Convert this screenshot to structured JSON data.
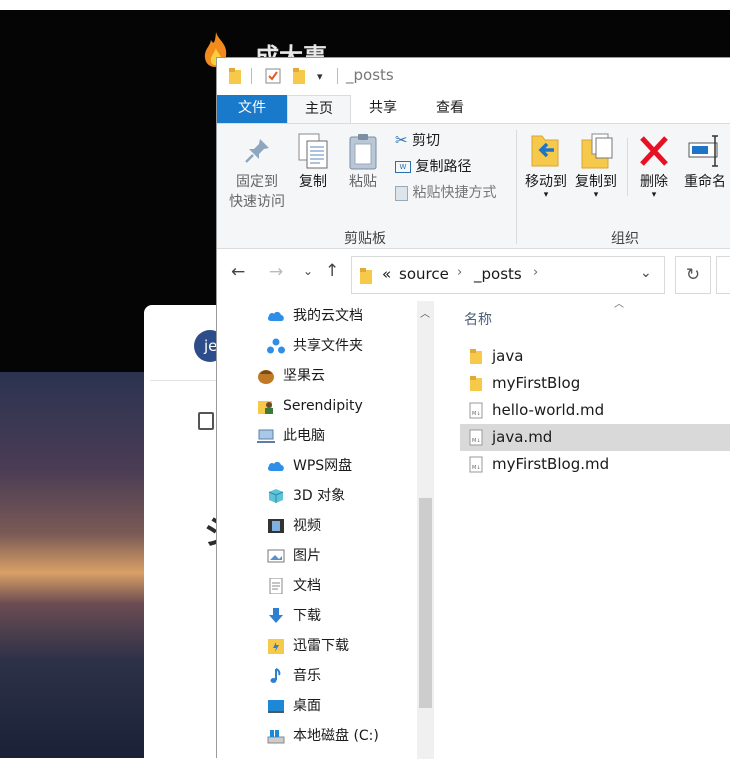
{
  "background": {
    "site_title": "成大事",
    "badge_text": "je",
    "heading_glyph": "ジ"
  },
  "explorer": {
    "title": "_posts",
    "tabs": [
      "文件",
      "主页",
      "共享",
      "查看"
    ],
    "ribbon": {
      "pin_line1": "固定到",
      "pin_line2": "快速访问",
      "copy": "复制",
      "paste": "粘贴",
      "cut": "剪切",
      "copy_path": "复制路径",
      "paste_shortcut": "粘贴快捷方式",
      "clipboard_group": "剪贴板",
      "move_to": "移动到",
      "copy_to": "复制到",
      "delete": "删除",
      "rename": "重命名",
      "organize_group": "组织"
    },
    "address": {
      "prefix": "«",
      "crumbs": [
        "source",
        "_posts"
      ]
    },
    "nav_items": [
      {
        "label": "我的云文档",
        "icon": "cloud-icon"
      },
      {
        "label": "共享文件夹",
        "icon": "share-network-icon"
      },
      {
        "label": "坚果云",
        "icon": "nut-icon"
      },
      {
        "label": "Serendipity",
        "icon": "user-folder-icon"
      },
      {
        "label": "此电脑",
        "icon": "computer-icon"
      },
      {
        "label": "WPS网盘",
        "icon": "cloud-icon"
      },
      {
        "label": "3D 对象",
        "icon": "cube-icon"
      },
      {
        "label": "视频",
        "icon": "video-icon"
      },
      {
        "label": "图片",
        "icon": "picture-icon"
      },
      {
        "label": "文档",
        "icon": "document-icon"
      },
      {
        "label": "下载",
        "icon": "download-icon"
      },
      {
        "label": "迅雷下载",
        "icon": "thunder-folder-icon"
      },
      {
        "label": "音乐",
        "icon": "music-icon"
      },
      {
        "label": "桌面",
        "icon": "desktop-icon"
      },
      {
        "label": "本地磁盘 (C:)",
        "icon": "disk-icon"
      }
    ],
    "column_header": "名称",
    "files": [
      {
        "name": "java",
        "type": "folder"
      },
      {
        "name": "myFirstBlog",
        "type": "folder"
      },
      {
        "name": "hello-world.md",
        "type": "markdown"
      },
      {
        "name": "java.md",
        "type": "markdown",
        "selected": true
      },
      {
        "name": "myFirstBlog.md",
        "type": "markdown"
      }
    ],
    "colors": {
      "file_tab": "#1979ca",
      "ribbon_bg": "#f5f6f7",
      "selection": "#d9d9d9",
      "folder": "#f7c94b",
      "delete_red": "#e81123"
    }
  }
}
